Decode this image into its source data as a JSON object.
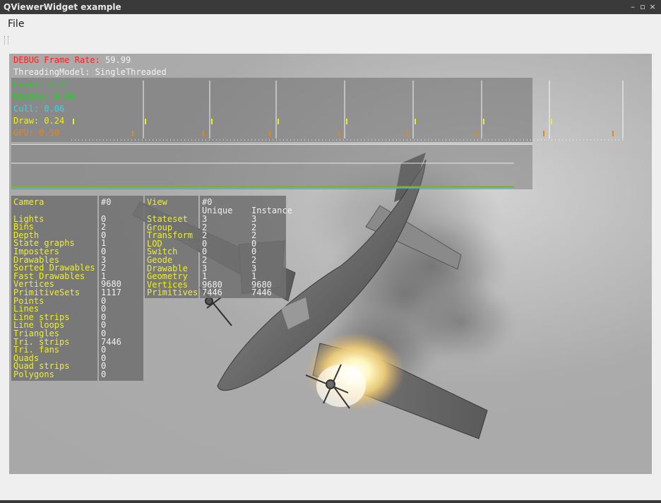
{
  "window": {
    "title": "QViewerWidget example",
    "minimize": "–",
    "maximize": "▫",
    "close": "×"
  },
  "menubar": {
    "file": "File"
  },
  "hud": {
    "frame_rate_label": "DEBUG Frame Rate: ",
    "frame_rate_value": "59.99",
    "threading": "ThreadingModel: SingleThreaded",
    "timings": [
      {
        "label": "Event: ",
        "value": "0.01"
      },
      {
        "label": "Update: ",
        "value": "0.00"
      },
      {
        "label": "Cull: ",
        "value": "0.06"
      },
      {
        "label": "Draw: ",
        "value": "0.24"
      },
      {
        "label": "GPU: ",
        "value": "0.50"
      }
    ]
  },
  "camera_stats": {
    "title": "Camera",
    "id": "#0",
    "rows": [
      {
        "label": "",
        "value": ""
      },
      {
        "label": "Lights",
        "value": "0"
      },
      {
        "label": "Bins",
        "value": "2"
      },
      {
        "label": "Depth",
        "value": "0"
      },
      {
        "label": "State graphs",
        "value": "1"
      },
      {
        "label": "Imposters",
        "value": "0"
      },
      {
        "label": "Drawables",
        "value": "3"
      },
      {
        "label": "Sorted Drawables",
        "value": "2"
      },
      {
        "label": "Fast Drawables",
        "value": "1"
      },
      {
        "label": "Vertices",
        "value": "9680"
      },
      {
        "label": "PrimitiveSets",
        "value": "1117"
      },
      {
        "label": "Points",
        "value": "0"
      },
      {
        "label": "Lines",
        "value": "0"
      },
      {
        "label": "Line strips",
        "value": "0"
      },
      {
        "label": "Line loops",
        "value": "0"
      },
      {
        "label": "Triangles",
        "value": "0"
      },
      {
        "label": "Tri. strips",
        "value": "7446"
      },
      {
        "label": "Tri. fans",
        "value": "0"
      },
      {
        "label": "Quads",
        "value": "0"
      },
      {
        "label": "Quad strips",
        "value": "0"
      },
      {
        "label": "Polygons",
        "value": "0"
      }
    ]
  },
  "view_stats": {
    "title": "View",
    "id": "#0",
    "col_unique": "Unique",
    "col_instance": "Instance",
    "rows": [
      {
        "label": "Stateset",
        "unique": "3",
        "instance": "3"
      },
      {
        "label": "Group",
        "unique": "2",
        "instance": "2"
      },
      {
        "label": "Transform",
        "unique": "2",
        "instance": "2"
      },
      {
        "label": "LOD",
        "unique": "0",
        "instance": "0"
      },
      {
        "label": "Switch",
        "unique": "0",
        "instance": "0"
      },
      {
        "label": "Geode",
        "unique": "2",
        "instance": "2"
      },
      {
        "label": "Drawable",
        "unique": "3",
        "instance": "3"
      },
      {
        "label": "Geometry",
        "unique": "1",
        "instance": "1"
      },
      {
        "label": "Vertices",
        "unique": "9680",
        "instance": "9680"
      },
      {
        "label": "Primitives",
        "unique": "7446",
        "instance": "7446"
      }
    ]
  }
}
